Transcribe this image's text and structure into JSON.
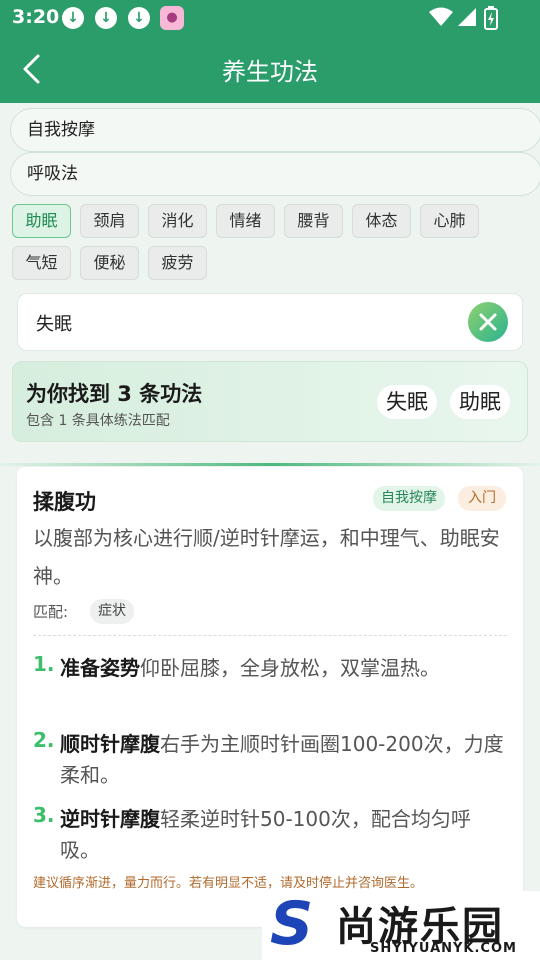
{
  "status_bar": {
    "time": "3:20"
  },
  "header": {
    "title": "养生功法"
  },
  "category_pills": [
    "自我按摩",
    "呼吸法"
  ],
  "symptom_tags": [
    {
      "label": "助眠",
      "active": true
    },
    {
      "label": "颈肩"
    },
    {
      "label": "消化"
    },
    {
      "label": "情绪"
    },
    {
      "label": "腰背"
    },
    {
      "label": "体态"
    },
    {
      "label": "心肺"
    },
    {
      "label": "气短"
    },
    {
      "label": "便秘"
    },
    {
      "label": "疲劳"
    }
  ],
  "search": {
    "value": "失眠"
  },
  "result": {
    "title": "为你找到 3 条功法",
    "subtitle": "包含 1 条具体练法匹配",
    "chips": [
      "失眠",
      "助眠"
    ]
  },
  "card": {
    "title": "揉腹功",
    "badge_category": "自我按摩",
    "badge_level": "入门",
    "description": "以腹部为核心进行顺/逆时针摩运，和中理气、助眠安神。",
    "match_label": "匹配:",
    "match_tag": "症状",
    "steps": [
      {
        "num": "1.",
        "title": "准备姿势",
        "text": "仰卧屈膝，全身放松，双掌温热。"
      },
      {
        "num": "2.",
        "title": "顺时针摩腹",
        "text": "右手为主顺时针画圈100-200次，力度柔和。"
      },
      {
        "num": "3.",
        "title": "逆时针摩腹",
        "text": "轻柔逆时针50-100次，配合均匀呼吸。"
      }
    ],
    "note": "建议循序渐进，量力而行。若有明显不适，请及时停止并咨询医生。"
  },
  "watermark": {
    "letter": "S",
    "text_cn": "尚游乐园",
    "text_en": "SHYIYUANYK.COM"
  },
  "colors": {
    "primary": "#2a9d6b",
    "accent_green": "#3cbf6b",
    "warning": "#b26a2c"
  }
}
